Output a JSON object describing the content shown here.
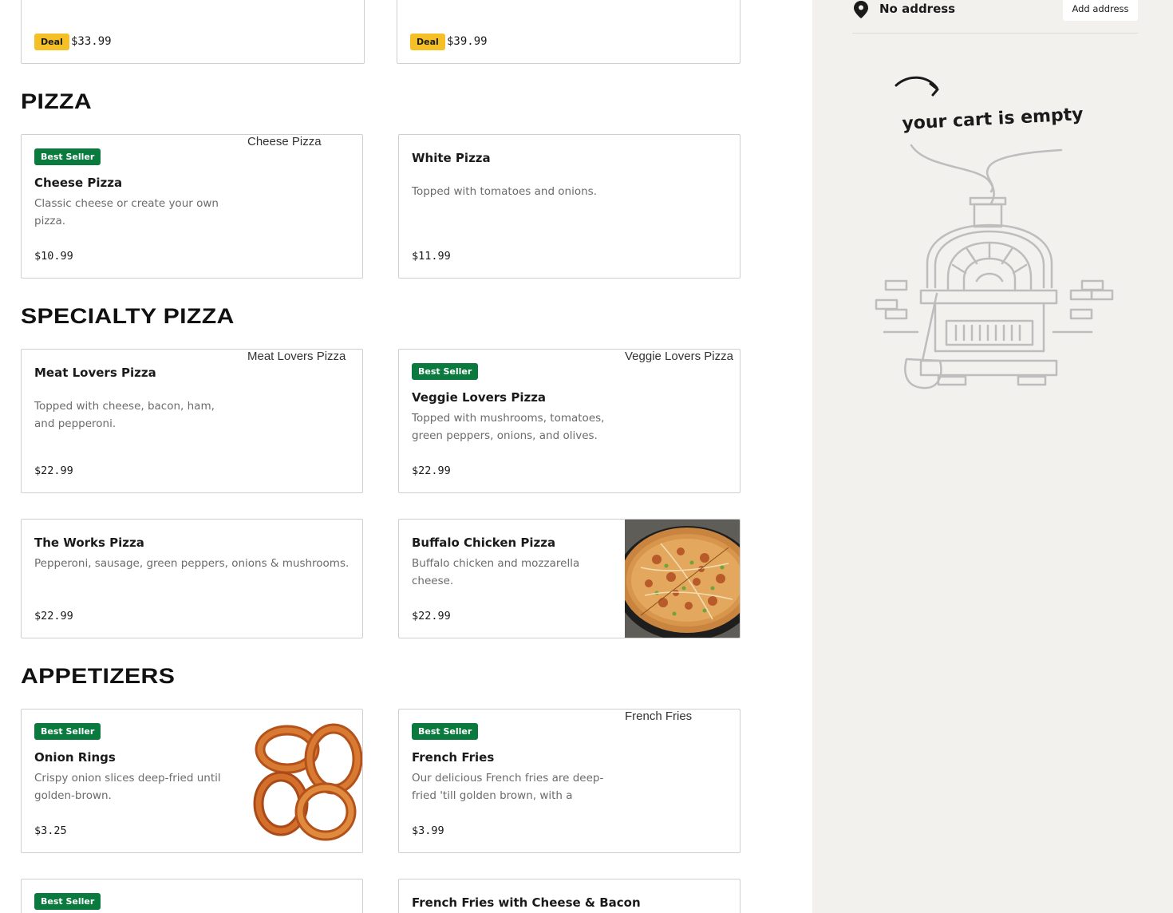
{
  "deals": [
    {
      "badge": "Deal",
      "price": "$33.99"
    },
    {
      "badge": "Deal",
      "price": "$39.99"
    }
  ],
  "sections": [
    {
      "title": "PIZZA"
    },
    {
      "title": "SPECIALTY PIZZA"
    },
    {
      "title": "APPETIZERS"
    }
  ],
  "items": {
    "cheese_pizza": {
      "badge": "Best Seller",
      "name": "Cheese Pizza",
      "desc": "Classic cheese or create your own pizza.",
      "price": "$10.99",
      "img_alt": "Cheese Pizza"
    },
    "white_pizza": {
      "name": "White Pizza",
      "desc": "Topped with tomatoes and onions.",
      "price": "$11.99"
    },
    "meat_lovers": {
      "name": "Meat Lovers Pizza",
      "desc": "Topped with cheese, bacon, ham, and pepperoni.",
      "price": "$22.99",
      "img_alt": "Meat Lovers Pizza"
    },
    "veggie_lovers": {
      "badge": "Best Seller",
      "name": "Veggie Lovers Pizza",
      "desc": "Topped with mushrooms, tomatoes, green peppers, onions, and olives.",
      "price": "$22.99",
      "img_alt": "Veggie Lovers Pizza"
    },
    "works_pizza": {
      "name": "The Works Pizza",
      "desc": "Pepperoni, sausage, green peppers, onions & mushrooms.",
      "price": "$22.99"
    },
    "buffalo_pizza": {
      "name": "Buffalo Chicken Pizza",
      "desc": "Buffalo chicken and mozzarella cheese.",
      "price": "$22.99"
    },
    "onion_rings": {
      "badge": "Best Seller",
      "name": "Onion Rings",
      "desc": "Crispy onion slices deep-fried until golden-brown.",
      "price": "$3.25"
    },
    "french_fries": {
      "badge": "Best Seller",
      "name": "French Fries",
      "desc": "Our delicious French fries are deep-fried 'till golden brown, with a crunch...",
      "price": "$3.99",
      "img_alt": "French Fries"
    },
    "next_left": {
      "badge": "Best Seller"
    },
    "fries_cheese_bacon": {
      "name": "French Fries with Cheese & Bacon"
    }
  },
  "sidebar": {
    "address": "No address",
    "add_address_label": "Add address",
    "empty_cart_text": "your cart is empty"
  },
  "colors": {
    "best_seller_badge": "#0b7a3e",
    "deal_badge": "#f5c026",
    "sidebar_bg": "#f2f1ee"
  }
}
